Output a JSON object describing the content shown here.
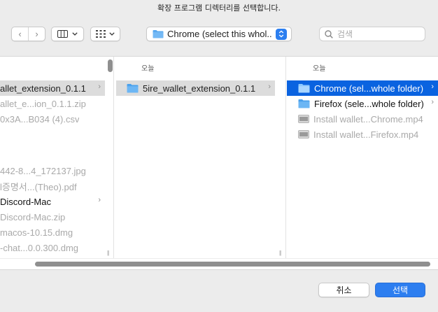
{
  "dialog": {
    "title": "확장 프로그램 디렉터리를 선택합니다."
  },
  "toolbar": {
    "back_glyph": "‹",
    "forward_glyph": "›",
    "path_label": "Chrome (select this whol...",
    "search_placeholder": "검색"
  },
  "columns": {
    "c1": {
      "items": [
        {
          "label": "allet_extension_0.1.1",
          "state": "selected-inactive",
          "has_children": true,
          "icon": "none"
        },
        {
          "label": "allet_e...ion_0.1.1.zip",
          "state": "dim",
          "has_children": false,
          "icon": "none"
        },
        {
          "label": "0x3A...B034 (4).csv",
          "state": "dim",
          "has_children": false,
          "icon": "none"
        },
        {
          "label": "442-8...4_172137.jpg",
          "state": "dim",
          "has_children": false,
          "icon": "none"
        },
        {
          "label": "l증명서...(Theo).pdf",
          "state": "dim",
          "has_children": false,
          "icon": "none"
        },
        {
          "label": "Discord-Mac",
          "state": "active",
          "has_children": true,
          "icon": "none"
        },
        {
          "label": "Discord-Mac.zip",
          "state": "dim",
          "has_children": false,
          "icon": "none"
        },
        {
          "label": "macos-10.15.dmg",
          "state": "dim",
          "has_children": false,
          "icon": "none"
        },
        {
          "label": "-chat...0.0.300.dmg",
          "state": "dim",
          "has_children": false,
          "icon": "none"
        }
      ]
    },
    "c2": {
      "header": "오늘",
      "items": [
        {
          "label": "5ire_wallet_extension_0.1.1",
          "state": "selected-inactive",
          "has_children": true,
          "icon": "folder-icon"
        }
      ]
    },
    "c3": {
      "header": "오늘",
      "items": [
        {
          "label": "Chrome (sel...whole folder)",
          "state": "selected",
          "has_children": true,
          "icon": "folder-icon"
        },
        {
          "label": "Firefox (sele...whole folder)",
          "state": "active",
          "has_children": true,
          "icon": "folder-icon"
        },
        {
          "label": "Install wallet...Chrome.mp4",
          "state": "dim",
          "has_children": false,
          "icon": "video-file-icon"
        },
        {
          "label": "Install wallet...Firefox.mp4",
          "state": "dim",
          "has_children": false,
          "icon": "video-file-icon"
        }
      ]
    }
  },
  "buttons": {
    "cancel": "취소",
    "choose": "선택"
  },
  "colors": {
    "accent": "#2d7ef0",
    "selection": "#0a63e0",
    "folder": "#5aa9ef"
  }
}
